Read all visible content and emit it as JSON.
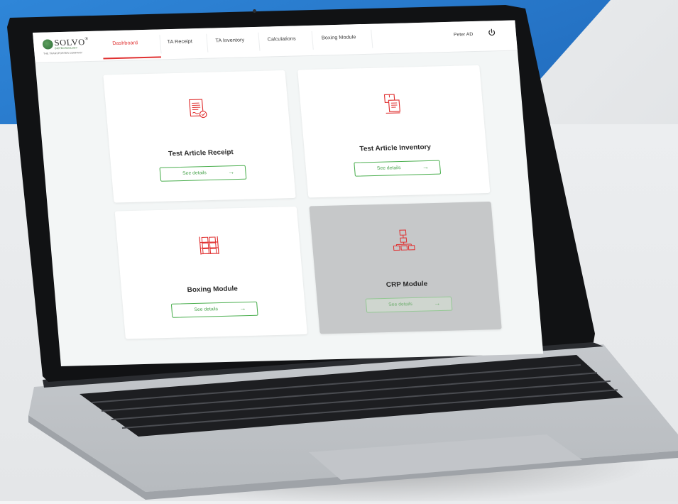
{
  "app": {
    "logo": {
      "name": "SOLVO",
      "registered": "®",
      "subtitle": "BIOTECHNOLOGY",
      "tagline": "THE TRANSPORTER COMPANY"
    },
    "nav": {
      "tabs": [
        {
          "label": "Dashboard",
          "active": true
        },
        {
          "label": "TA Receipt",
          "active": false
        },
        {
          "label": "TA Inventory",
          "active": false
        },
        {
          "label": "Calculations",
          "active": false
        },
        {
          "label": "Boxing Module",
          "active": false
        }
      ],
      "user_name": "Peter AD",
      "power_icon": "power-icon"
    },
    "cards": [
      {
        "title": "Test Article Receipt",
        "button_label": "See details",
        "icon": "document-check-icon",
        "disabled": false
      },
      {
        "title": "Test Article Inventory",
        "button_label": "See details",
        "icon": "box-documents-icon",
        "disabled": false
      },
      {
        "title": "Boxing Module",
        "button_label": "See details",
        "icon": "shelves-boxes-icon",
        "disabled": false
      },
      {
        "title": "CRP Module",
        "button_label": "See details",
        "icon": "hierarchy-boxes-icon",
        "disabled": true
      }
    ],
    "arrow_glyph": "→"
  },
  "colors": {
    "accent_red": "#e03131",
    "button_green": "#43a047",
    "screen_bg": "#f3f6f6",
    "disabled_card": "#c6c8c9",
    "backdrop_blue": "#1c62b4"
  }
}
